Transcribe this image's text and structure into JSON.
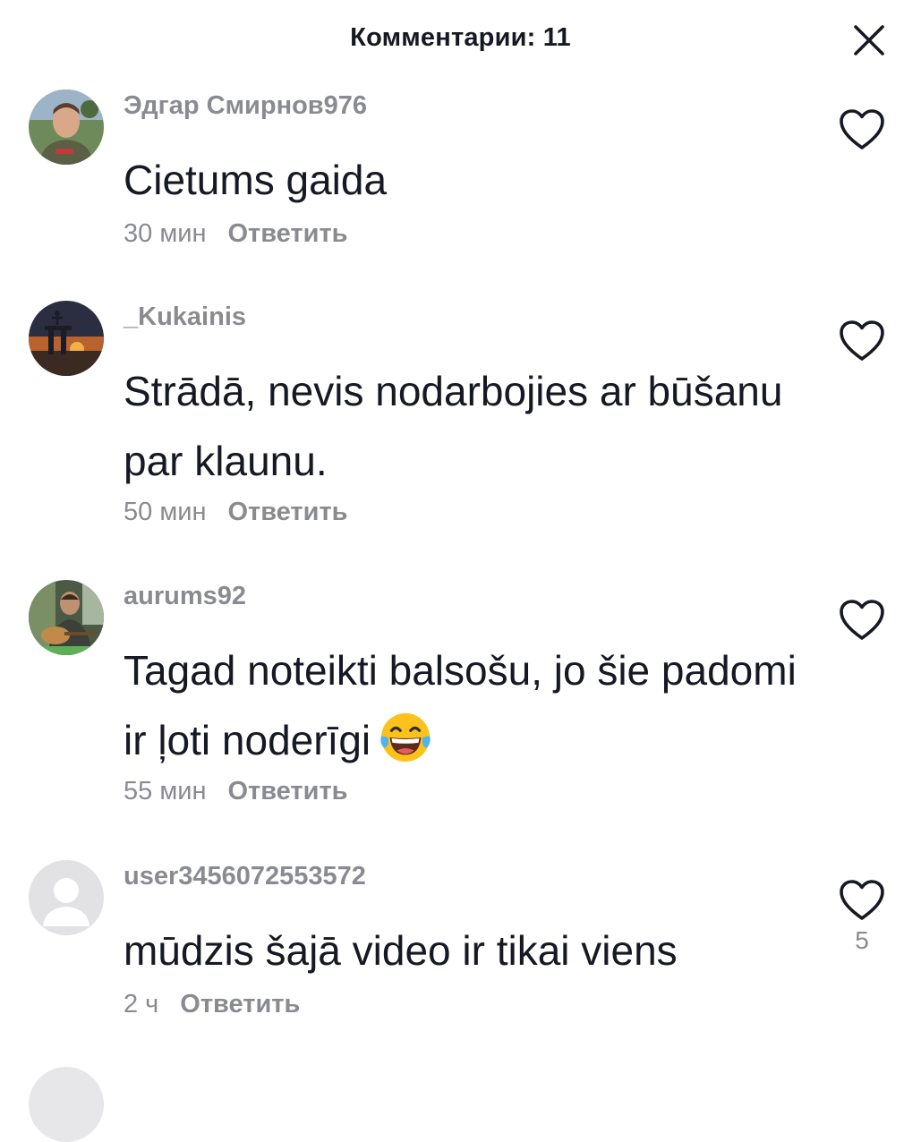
{
  "header": {
    "title": "Комментарии: 11",
    "close_icon": "close-icon"
  },
  "reply_label": "Ответить",
  "comments": [
    {
      "username": "Эдгар Смирнов976",
      "text": "Cietums gaida",
      "time": "30 мин",
      "like_count": ""
    },
    {
      "username": "_Kukainis",
      "text": "Strādā, nevis nodarbojies ar būšanu par klaunu.",
      "time": "50 мин",
      "like_count": ""
    },
    {
      "username": "aurums92",
      "text": "Tagad noteikti balsošu, jo šie padomi ir ļoti noderīgi",
      "emoji": "face-with-tears-of-joy",
      "time": "55 мин",
      "like_count": ""
    },
    {
      "username": "user3456072553572",
      "text": "mūdzis šajā video ir tikai viens",
      "time": "2 ч",
      "like_count": "5"
    }
  ],
  "colors": {
    "primary_text": "#161823",
    "secondary_text": "#8a8b91",
    "background": "#ffffff"
  }
}
